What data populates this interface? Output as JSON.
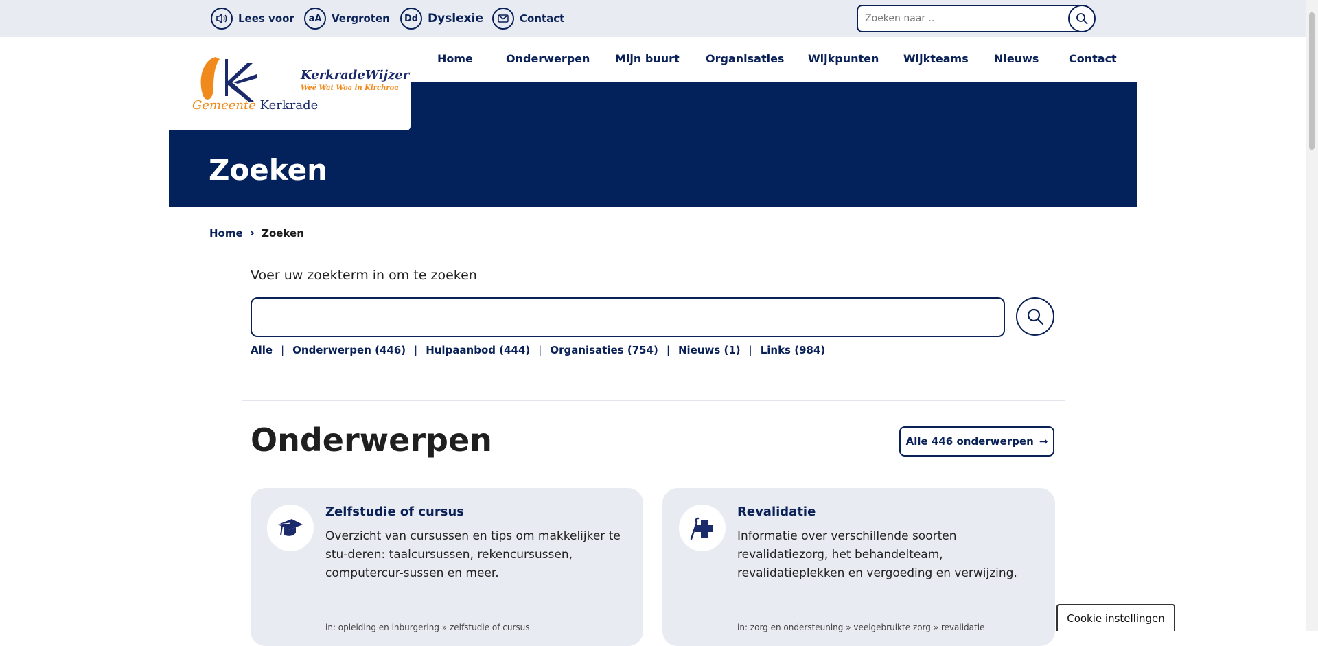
{
  "utility": {
    "read_aloud": "Lees voor",
    "enlarge": "Vergroten",
    "enlarge_glyph": "aA",
    "dyslexia": "Dyslexie",
    "dyslexia_glyph": "Dd",
    "contact": "Contact",
    "search_placeholder": "Zoeken naar .."
  },
  "logo": {
    "brand": "KerkradeWijzer",
    "tagline": "Weë Wat Woa in Kirchroa",
    "municipality_a": "Gemeente ",
    "municipality_b": "Kerkrade"
  },
  "nav": [
    "Home",
    "Onderwerpen",
    "Mijn buurt",
    "Organisaties",
    "Wijkpunten",
    "Wijkteams",
    "Nieuws",
    "Contact"
  ],
  "hero": {
    "title": "Zoeken"
  },
  "breadcrumb": {
    "home": "Home",
    "separator": "›",
    "current": "Zoeken"
  },
  "search": {
    "label": "Voer uw zoekterm in om te zoeken",
    "value": "",
    "filters": [
      "Alle",
      "Onderwerpen (446)",
      "Hulpaanbod (444)",
      "Organisaties (754)",
      "Nieuws (1)",
      "Links (984)"
    ],
    "separator": "|"
  },
  "section": {
    "title": "Onderwerpen",
    "all_button": "Alle 446 onderwerpen",
    "arrow": "→"
  },
  "cards": [
    {
      "title": "Zelfstudie of cursus",
      "description": "Overzicht van cursussen en tips om makkelijker te stu-deren: taalcursussen, rekencursussen, computercur-sussen en meer.",
      "path": "in: opleiding en inburgering » zelfstudie of cursus",
      "icon": "graduation-cap-icon"
    },
    {
      "title": "Revalidatie",
      "description": "Informatie over verschillende soorten revalidatiezorg, het behandelteam, revalidatieplekken en vergoeding en verwijzing.",
      "path": "in: zorg en ondersteuning » veelgebruikte zorg » revalidatie",
      "icon": "medical-cross-cane-icon"
    }
  ],
  "cookie": {
    "label": "Cookie instellingen"
  },
  "colors": {
    "navy": "#03215a",
    "text_navy": "#0a2157",
    "topbar": "#e8ebf1",
    "card": "#e8ebf1",
    "orange": "#f08a1c"
  }
}
